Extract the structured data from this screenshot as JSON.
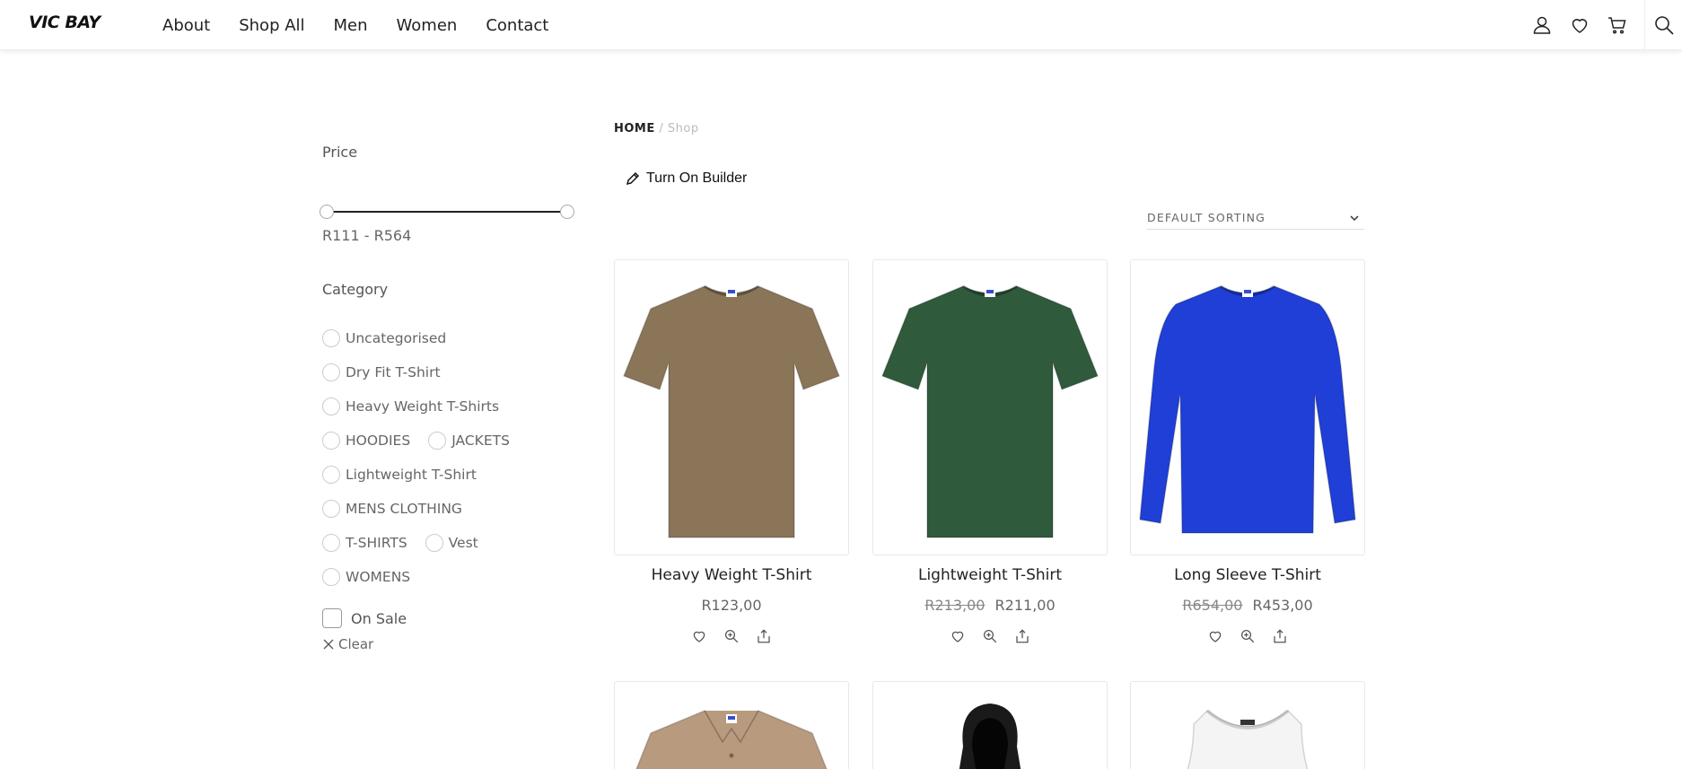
{
  "brand": {
    "logo_text": "VIC BAY"
  },
  "nav": {
    "items": [
      "About",
      "Shop All",
      "Men",
      "Women",
      "Contact"
    ]
  },
  "header_icons": [
    "user-icon",
    "heart-icon",
    "cart-icon",
    "search-icon"
  ],
  "filters": {
    "price_title": "Price",
    "price_range": "R111 - R564",
    "category_title": "Category",
    "category_rows": [
      [
        "Uncategorised"
      ],
      [
        "Dry Fit T-Shirt"
      ],
      [
        "Heavy Weight T-Shirts"
      ],
      [
        "HOODIES",
        "JACKETS"
      ],
      [
        "Lightweight T-Shirt"
      ],
      [
        "MENS CLOTHING"
      ],
      [
        "T-SHIRTS",
        "Vest"
      ],
      [
        "WOMENS"
      ]
    ],
    "on_sale_label": "On Sale",
    "clear_label": "Clear"
  },
  "breadcrumb": {
    "home": "HOME",
    "separator": "/",
    "current": "Shop"
  },
  "builder_label": "Turn On Builder",
  "sorting": {
    "selected": "DEFAULT SORTING"
  },
  "products": [
    {
      "name": "Heavy Weight T-Shirt",
      "old_price": "",
      "price": "R123,00",
      "color": "#8b7558",
      "style": "tee"
    },
    {
      "name": "Lightweight T-Shirt",
      "old_price": "R213,00",
      "price": "R211,00",
      "color": "#2f5a3c",
      "style": "tee"
    },
    {
      "name": "Long Sleeve T-Shirt",
      "old_price": "R654,00",
      "price": "R453,00",
      "color": "#1f3fd6",
      "style": "long"
    }
  ],
  "products_row2": [
    {
      "color": "#b89a7e",
      "style": "polo"
    },
    {
      "color": "#1a1a1a",
      "style": "hoodie"
    },
    {
      "color": "#f4f4f4",
      "style": "vest"
    }
  ]
}
